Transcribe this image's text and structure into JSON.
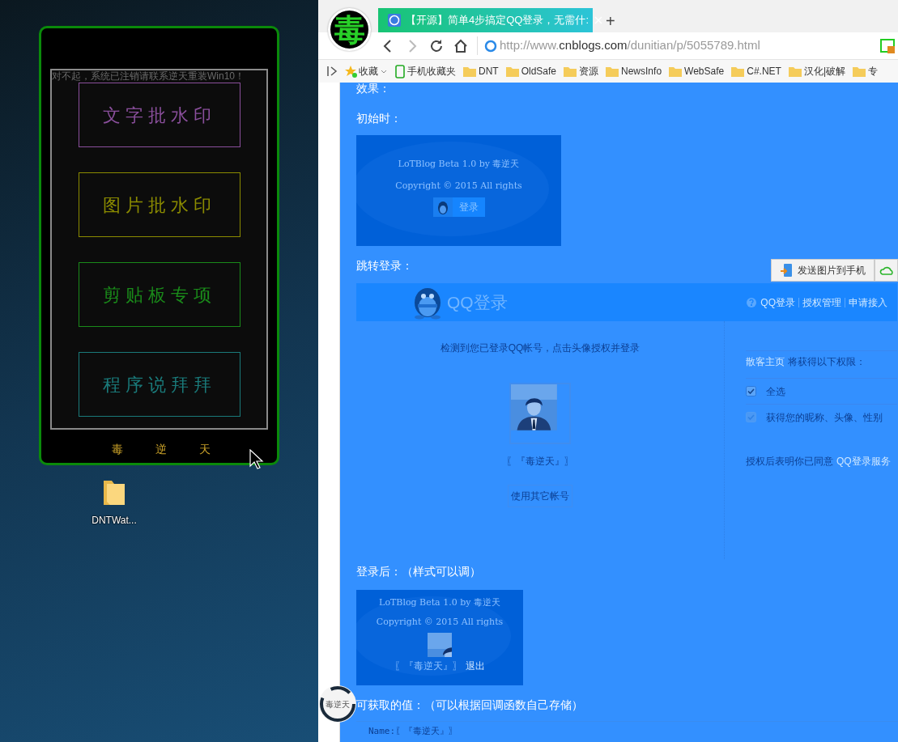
{
  "app_window": {
    "notice": "对不起，系统已注销请联系逆天重装Win10！",
    "buttons": [
      {
        "label": "文字批水印",
        "color": "#8a4f9c"
      },
      {
        "label": "图片批水印",
        "color": "#8b8b00"
      },
      {
        "label": "剪贴板专项",
        "color": "#1a8a1a"
      },
      {
        "label": "程序说拜拜",
        "color": "#1a7a7a"
      }
    ],
    "footer": [
      "毒",
      "逆",
      "天"
    ]
  },
  "desktop_icons": [
    {
      "label": "DNTWat..."
    }
  ],
  "browser": {
    "logo": "毒",
    "tabs": [
      {
        "title": "【开源】简单4步搞定QQ登录，无需什:",
        "selected": true
      }
    ],
    "new_tab": "+",
    "address": {
      "scheme_host": "http://www.",
      "domain": "cnblogs.com",
      "path": "/dunitian/p/5055789.html"
    },
    "bookmarks": [
      {
        "label": "收藏",
        "kind": "favorites"
      },
      {
        "label": "手机收藏夹",
        "kind": "phone"
      },
      {
        "label": "DNT",
        "kind": "folder"
      },
      {
        "label": "OldSafe",
        "kind": "folder"
      },
      {
        "label": "资源",
        "kind": "folder"
      },
      {
        "label": "NewsInfo",
        "kind": "folder"
      },
      {
        "label": "WebSafe",
        "kind": "folder"
      },
      {
        "label": "C#.NET",
        "kind": "folder"
      },
      {
        "label": "汉化|破解",
        "kind": "folder"
      },
      {
        "label": "专",
        "kind": "folder"
      }
    ]
  },
  "article": {
    "effect_label": "效果：",
    "initial_label": "初始时：",
    "initial_preview": {
      "title": "LoTBlog Beta 1.0 by 毒逆天",
      "copyright": "Copyright © 2015 All rights",
      "login_button": "登录"
    },
    "redirect_label": "跳转登录：",
    "qq_login": {
      "brand": "QQ登录",
      "links": [
        "QQ登录",
        "授权管理",
        "申请接入"
      ],
      "prompt": "检测到您已登录QQ帐号，点击头像授权并登录",
      "nickname": "〖『毒逆天』〗",
      "switch_button": "使用其它帐号",
      "site_link": "散客主页",
      "permission_intro": "将获得以下权限：",
      "permissions": [
        {
          "label": "全选",
          "checked": true,
          "disabled": false
        },
        {
          "label": "获得您的昵称、头像、性别",
          "checked": true,
          "disabled": true
        }
      ],
      "agreement": "授权后表明你已同意",
      "agreement_link": "QQ登录服务"
    },
    "after_label": "登录后：（样式可以调）",
    "after_preview": {
      "title": "LoTBlog Beta 1.0 by 毒逆天",
      "copyright": "Copyright © 2015 All rights",
      "nickname": "〖『毒逆天』〗",
      "logout": "退出"
    },
    "values_label": "可获取的值：（可以根据回调函数自己存储）",
    "values_code": "Name:〖『毒逆天』〗"
  },
  "send_to_phone": "发送图片到手机",
  "loading_text": "毒逆天"
}
